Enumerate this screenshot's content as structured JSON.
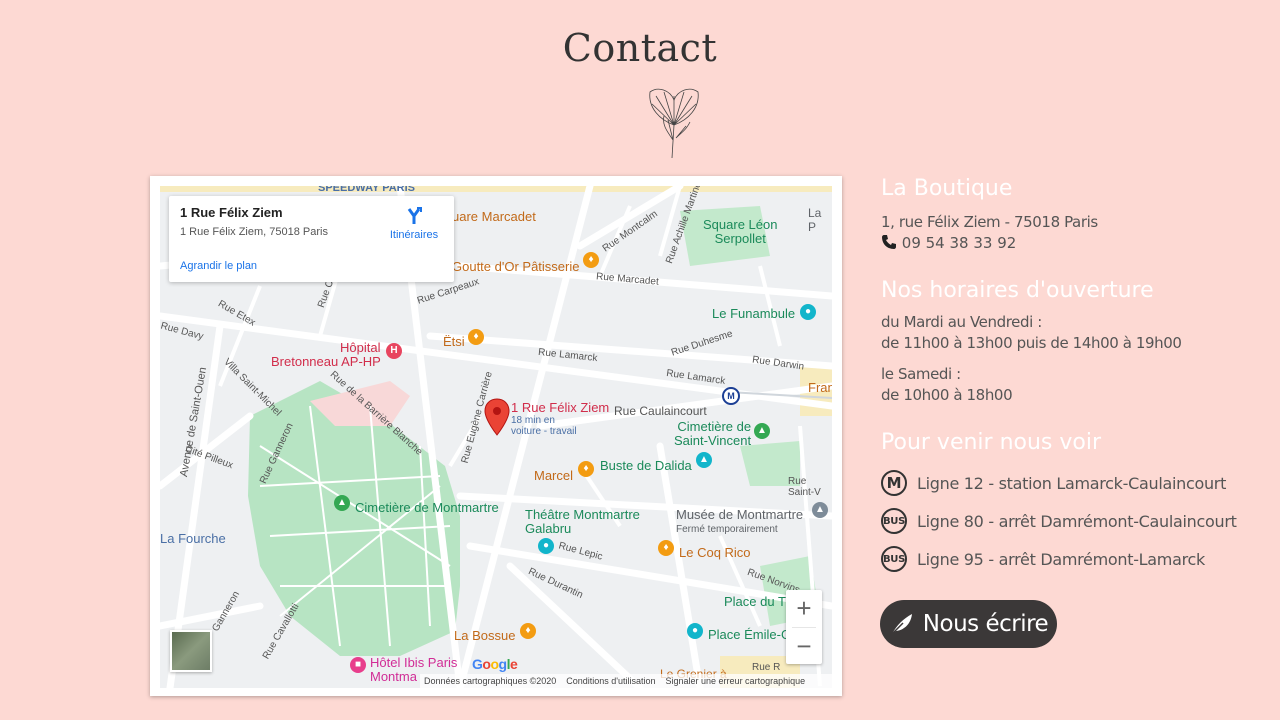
{
  "page": {
    "title": "Contact"
  },
  "map": {
    "info": {
      "title": "1 Rue Félix Ziem",
      "address": "1 Rue Félix Ziem, 75018 Paris",
      "directions_label": "Itinéraires",
      "enlarge_label": "Agrandir le plan"
    },
    "pin_label": "1 Rue Félix Ziem",
    "pin_sub1": "18 min en",
    "pin_sub2": "voiture - travail",
    "places": {
      "speedway": "SPEEDWAY PARIS",
      "square_marcadet": "uare Marcadet",
      "goutte": "Goutte d'Or Pâtisserie",
      "square_leon": "Square Léon",
      "serpollet": "Serpollet",
      "funambule": "Le Funambule",
      "hopital": "Hôpital",
      "bretonneau": "Bretonneau AP-HP",
      "etsi": "Ëtsi",
      "cimetiere_vincent": "Cimetière de",
      "saint_vincent": "Saint-Vincent",
      "marcel": "Marcel",
      "buste": "Buste de Dalida",
      "cimetiere_montmartre": "Cimetière de Montmartre",
      "theatre": "Théâtre Montmartre",
      "galabru": "Galabru",
      "musee": "Musée de Montmartre",
      "ferme": "Fermé temporairement",
      "coq": "Le Coq Rico",
      "fourche": "La Fourche",
      "bossue": "La Bossue",
      "place_du": "Place du T",
      "place_emile": "Place Émile-G",
      "hotel": "Hôtel Ibis Paris",
      "montma": "Montma",
      "grenier": "Le Grenier à",
      "lap": "La P",
      "fran": "Fran",
      "rue_montcalm": "Rue Montcalm",
      "rue_achille": "Rue Achille Martinet",
      "rue_marcadet": "Rue Marcadet",
      "rue_carpeaux": "Rue Carpeaux",
      "rue_lamarck": "Rue Lamarck",
      "rue_duhesme": "Rue Duhesme",
      "rue_darwin": "Rue Darwin",
      "rue_lamarck2": "Rue Lamarck",
      "rue_caulaincourt": "Rue Caulaincourt",
      "rue_davy": "Rue Davy",
      "rue_etex": "Rue Etex",
      "villa_saint_michel": "Villa Saint-Michel",
      "avenue_saint_ouen": "Avenue de Saint-Ouen",
      "cite_pilleux": "Cité Pilleux",
      "rue_ganneron": "Rue Ganneron",
      "rue_barriere": "Rue de la Barrière Blanche",
      "rue_eugene": "Rue Eugène Carrière",
      "rue_lepic": "Rue Lepic",
      "rue_durantin": "Rue Durantin",
      "rue_norvins": "Rue Norvins",
      "rue_saint_v": "Rue Saint-V",
      "rue_cavallotti": "Rue Cavallotti",
      "rue_r": "Rue R",
      "ganneron2": "Ganneron",
      "rue_c": "Rue Co"
    },
    "google": "Google",
    "footer": {
      "data": "Données cartographiques ©2020",
      "terms": "Conditions d'utilisation",
      "report": "Signaler une erreur cartographique"
    },
    "zoom_in": "+",
    "zoom_out": "−"
  },
  "boutique": {
    "heading": "La Boutique",
    "address": "1, rue Félix Ziem - 75018 Paris",
    "phone": "09 54 38 33 92"
  },
  "hours": {
    "heading": "Nos horaires d'ouverture",
    "line1": "du Mardi au Vendredi :",
    "line2": "de 11h00 à 13h00 puis de 14h00 à 19h00",
    "line3": "le Samedi :",
    "line4": "de 10h00 à 18h00"
  },
  "access": {
    "heading": "Pour venir nous voir",
    "items": [
      {
        "badge": "M",
        "text": "Ligne 12 - station Lamarck-Caulaincourt"
      },
      {
        "badge": "BUS",
        "text": "Ligne 80 - arrêt Damrémont-Caulaincourt"
      },
      {
        "badge": "BUS",
        "text": "Ligne 95 - arrêt Damrémont-Lamarck"
      }
    ]
  },
  "cta": {
    "label": "Nous écrire"
  }
}
